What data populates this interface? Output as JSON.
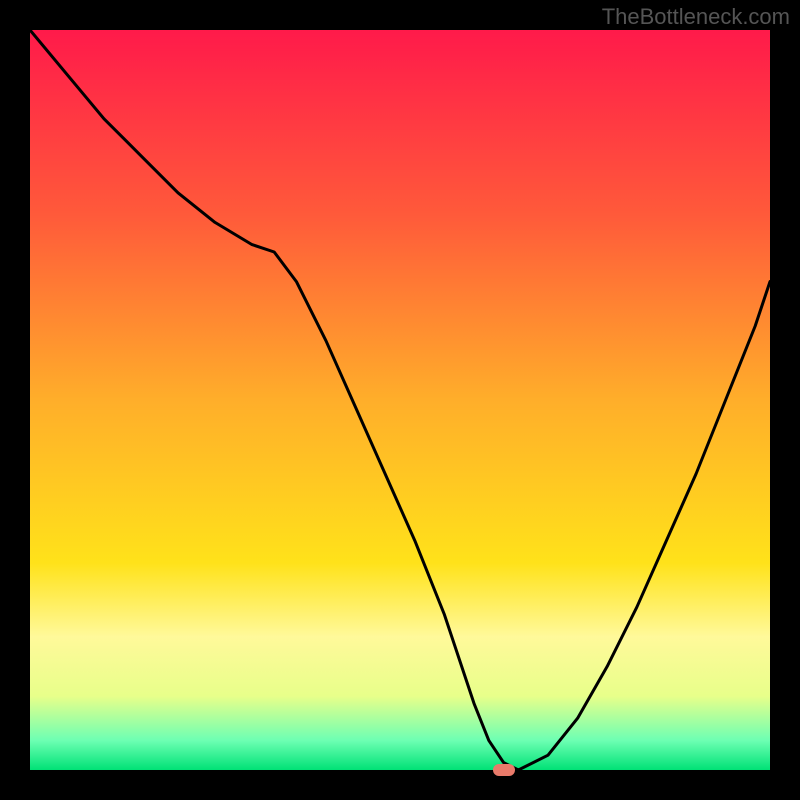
{
  "watermark": "TheBottleneck.com",
  "chart_data": {
    "type": "line",
    "title": "",
    "xlabel": "",
    "ylabel": "",
    "xlim": [
      0,
      100
    ],
    "ylim": [
      0,
      100
    ],
    "x": [
      0,
      5,
      10,
      15,
      20,
      25,
      30,
      33,
      36,
      40,
      44,
      48,
      52,
      56,
      58,
      60,
      62,
      64,
      66,
      70,
      74,
      78,
      82,
      86,
      90,
      94,
      98,
      100
    ],
    "values": [
      100,
      94,
      88,
      83,
      78,
      74,
      71,
      70,
      66,
      58,
      49,
      40,
      31,
      21,
      15,
      9,
      4,
      1,
      0,
      2,
      7,
      14,
      22,
      31,
      40,
      50,
      60,
      66
    ],
    "marker": {
      "x": 64,
      "y": 0
    },
    "background_gradient": [
      "#ff1a4a",
      "#ff5a3a",
      "#ffae2a",
      "#ffe21a",
      "#fff99a",
      "#e8ff8a",
      "#6dffb3",
      "#00e276"
    ]
  }
}
